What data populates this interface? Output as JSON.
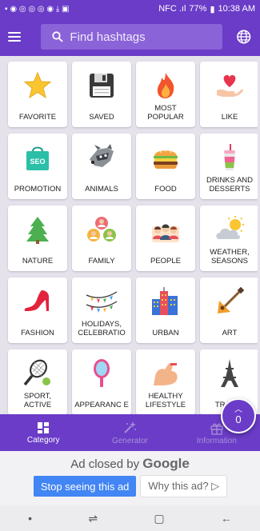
{
  "status": {
    "left_icons": "▪ ◉ ◎ ◎ ◎ ◉ ⤓ ▣",
    "signal": "NFC .ıl",
    "battery": "77%",
    "time": "10:38 AM"
  },
  "appbar": {
    "search_placeholder": "Find hashtags"
  },
  "categories": [
    {
      "label": "FAVORITE",
      "icon": "star-icon"
    },
    {
      "label": "SAVED",
      "icon": "floppy-disk-icon"
    },
    {
      "label": "MOST POPULAR",
      "icon": "flame-icon"
    },
    {
      "label": "LIKE",
      "icon": "heart-hand-icon"
    },
    {
      "label": "PROMOTION",
      "icon": "seo-bag-icon"
    },
    {
      "label": "ANIMALS",
      "icon": "raccoon-icon"
    },
    {
      "label": "FOOD",
      "icon": "burger-icon"
    },
    {
      "label": "DRINKS AND DESSERTS",
      "icon": "drink-icon"
    },
    {
      "label": "NATURE",
      "icon": "tree-icon"
    },
    {
      "label": "FAMILY",
      "icon": "family-icon"
    },
    {
      "label": "PEOPLE",
      "icon": "people-icon"
    },
    {
      "label": "WEATHER, SEASONS",
      "icon": "weather-icon"
    },
    {
      "label": "FASHION",
      "icon": "high-heel-icon"
    },
    {
      "label": "HOLIDAYS, CELEBRATIO",
      "icon": "garland-icon"
    },
    {
      "label": "URBAN",
      "icon": "buildings-icon"
    },
    {
      "label": "ART",
      "icon": "balalaika-icon"
    },
    {
      "label": "SPORT, ACTIVE",
      "icon": "tennis-icon"
    },
    {
      "label": "APPEARANC E",
      "icon": "mirror-icon"
    },
    {
      "label": "HEALTHY LIFESTYLE",
      "icon": "bicep-icon"
    },
    {
      "label": "TRAVEL",
      "icon": "eiffel-tower-icon"
    }
  ],
  "fab": {
    "chevron": "︿",
    "count": "0"
  },
  "bottom_nav": [
    {
      "label": "Category"
    },
    {
      "label": "Generator"
    },
    {
      "label": "Information"
    }
  ],
  "ad": {
    "closed_prefix": "Ad closed by ",
    "closed_brand": "Google",
    "stop_label": "Stop seeing this ad",
    "why_label": "Why this ad? ▷"
  },
  "colors": {
    "primary": "#6a3cc7",
    "ad_button": "#4285f4"
  }
}
